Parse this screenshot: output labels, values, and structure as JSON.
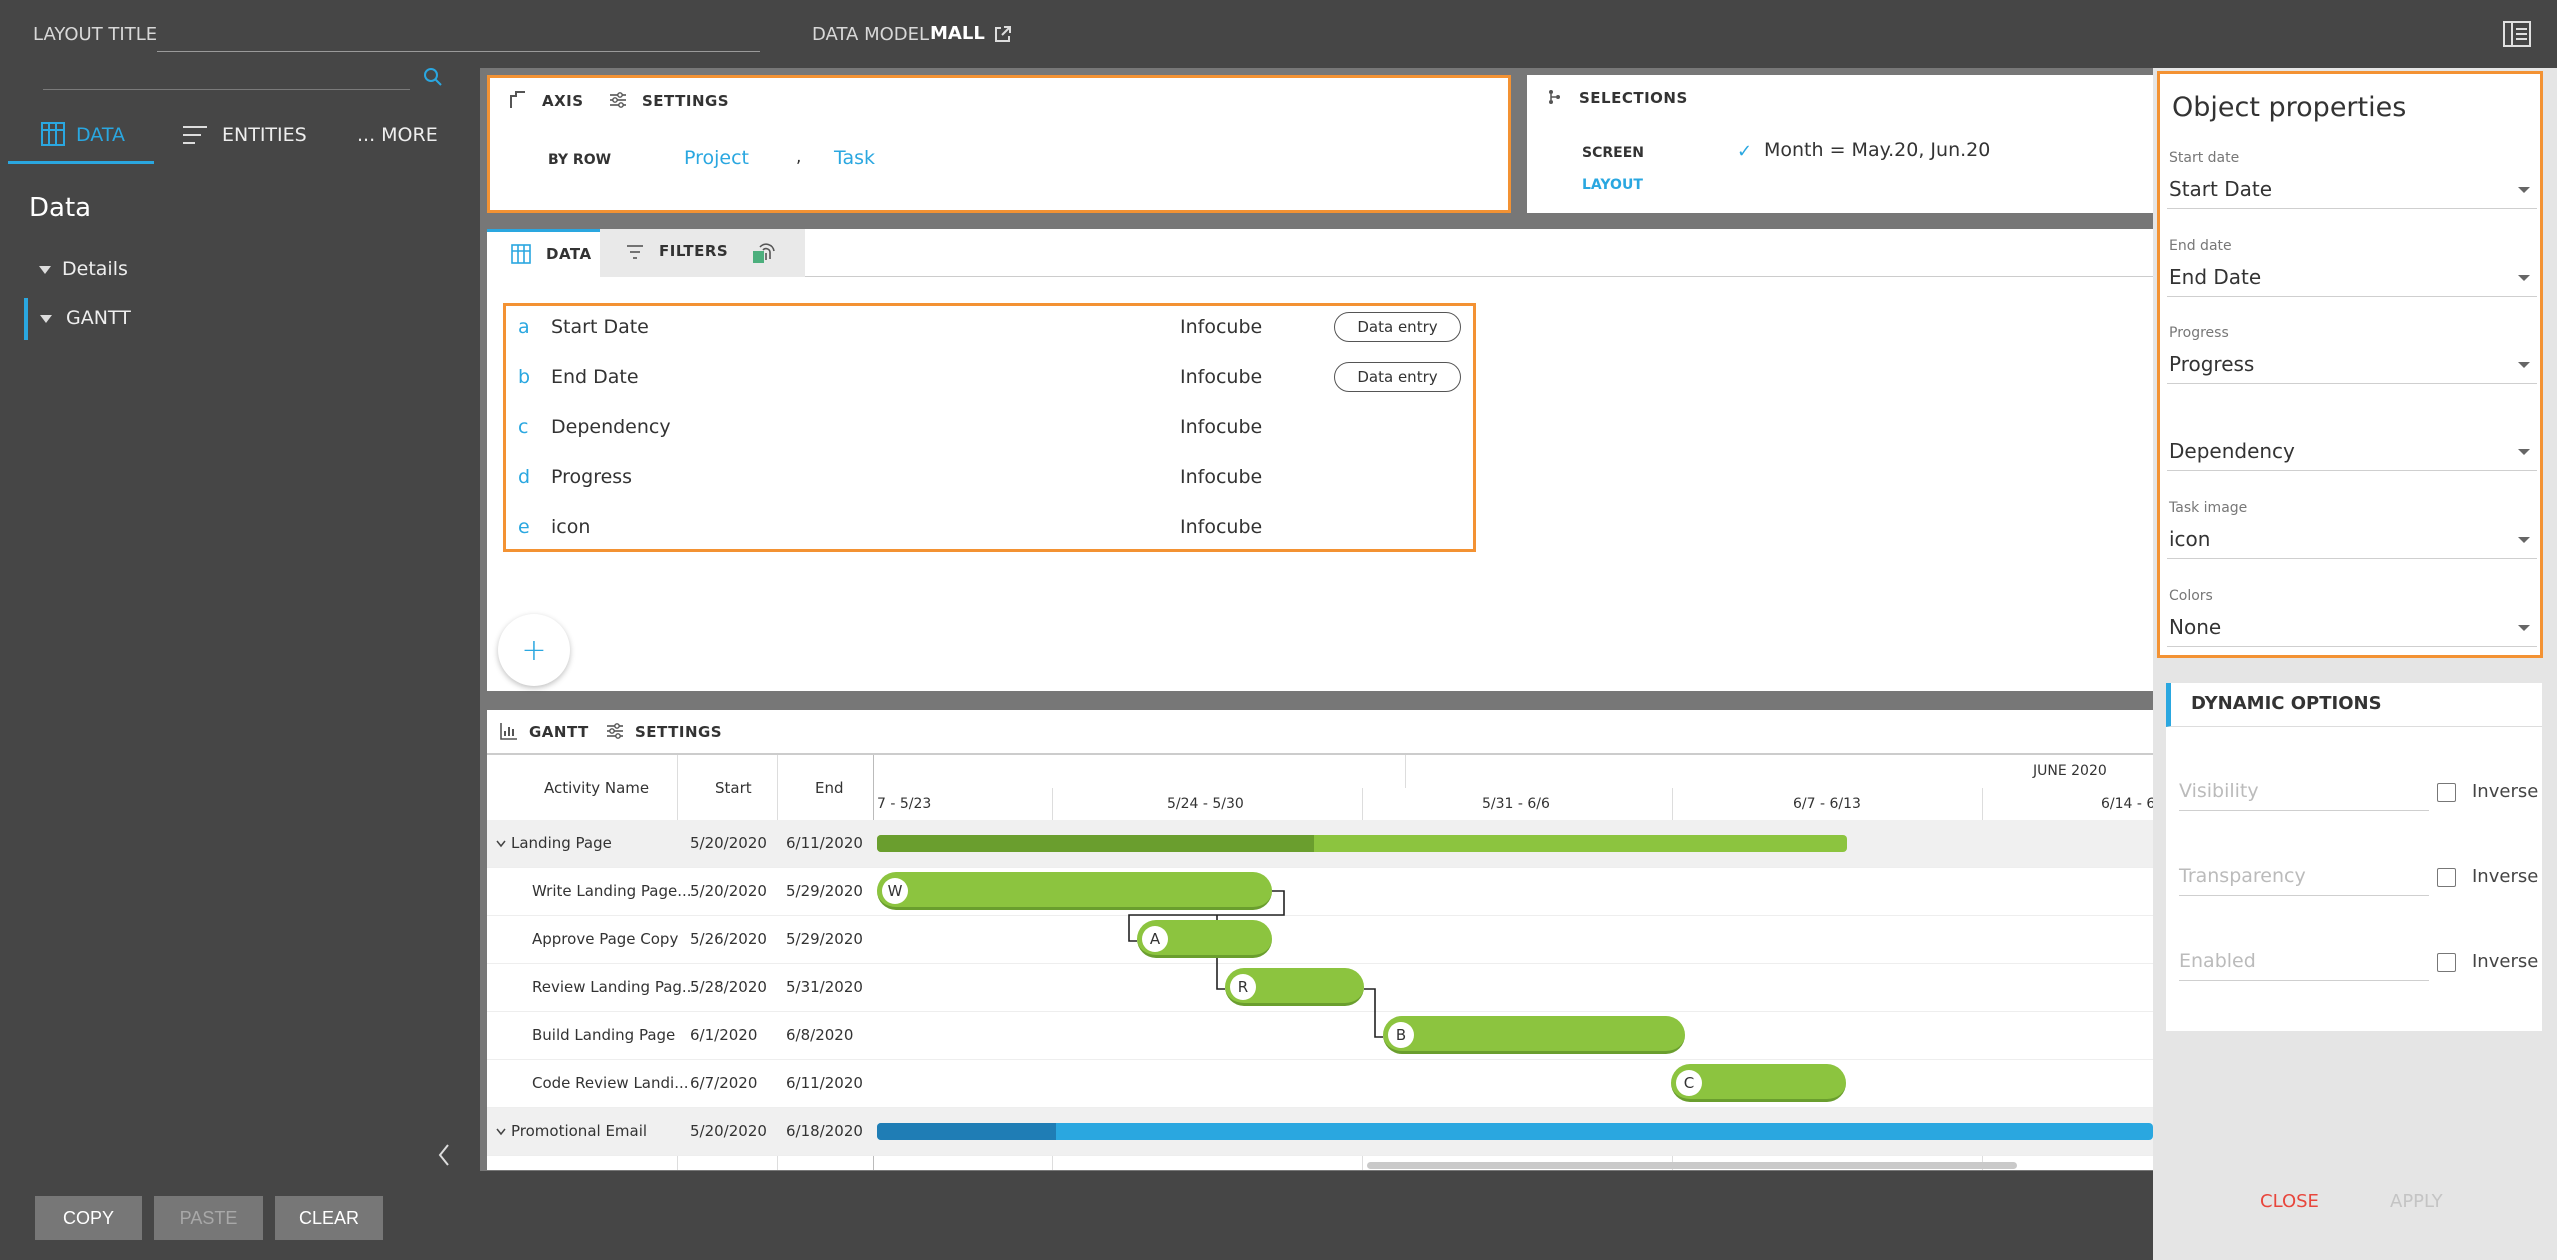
{
  "header": {
    "layout_title_label": "LAYOUT TITLE",
    "data_model_label": "DATA MODEL",
    "data_model_value": "MALL"
  },
  "left_panel": {
    "tabs": [
      "DATA",
      "ENTITIES",
      "... MORE"
    ],
    "section_title": "Data",
    "tree": [
      {
        "label": "Details"
      },
      {
        "label": "GANTT"
      }
    ],
    "buttons": {
      "copy": "COPY",
      "paste": "PASTE",
      "clear": "CLEAR"
    }
  },
  "axis_panel": {
    "tab_axis": "AXIS",
    "tab_settings": "SETTINGS",
    "by_row_label": "BY ROW",
    "row_items": [
      "Project",
      "Task"
    ],
    "separator": ","
  },
  "selections_panel": {
    "title": "SELECTIONS",
    "screen_label": "SCREEN",
    "screen_value": "Month = May.20, Jun.20",
    "layout_label": "LAYOUT"
  },
  "data_tabs": {
    "data": "DATA",
    "filters": "FILTERS"
  },
  "data_rows": [
    {
      "letter": "a",
      "name": "Start Date",
      "source": "Infocube",
      "action": "Data entry"
    },
    {
      "letter": "b",
      "name": "End Date",
      "source": "Infocube",
      "action": "Data entry"
    },
    {
      "letter": "c",
      "name": "Dependency",
      "source": "Infocube",
      "action": ""
    },
    {
      "letter": "d",
      "name": "Progress",
      "source": "Infocube",
      "action": ""
    },
    {
      "letter": "e",
      "name": "icon",
      "source": "Infocube",
      "action": ""
    }
  ],
  "add_button": "+",
  "gantt": {
    "tab_gantt": "GANTT",
    "tab_settings": "SETTINGS",
    "columns": {
      "activity": "Activity Name",
      "start": "Start",
      "end": "End"
    },
    "month_label": "JUNE 2020",
    "weeks": [
      "7 - 5/23",
      "5/24 - 5/30",
      "5/31 - 6/6",
      "6/7 - 6/13",
      "6/14 - 6/"
    ],
    "rows": [
      {
        "name": "Landing Page",
        "start": "5/20/2020",
        "end": "6/11/2020",
        "group": true,
        "bar_letter": "",
        "progress": 0.45
      },
      {
        "name": "Write Landing Page...",
        "start": "5/20/2020",
        "end": "5/29/2020",
        "group": false,
        "bar_letter": "W"
      },
      {
        "name": "Approve Page Copy",
        "start": "5/26/2020",
        "end": "5/29/2020",
        "group": false,
        "bar_letter": "A"
      },
      {
        "name": "Review Landing Pag...",
        "start": "5/28/2020",
        "end": "5/31/2020",
        "group": false,
        "bar_letter": "R"
      },
      {
        "name": "Build Landing Page",
        "start": "6/1/2020",
        "end": "6/8/2020",
        "group": false,
        "bar_letter": "B"
      },
      {
        "name": "Code Review Landi...",
        "start": "6/7/2020",
        "end": "6/11/2020",
        "group": false,
        "bar_letter": "C"
      },
      {
        "name": "Promotional Email",
        "start": "5/20/2020",
        "end": "6/18/2020",
        "group": true,
        "bar_letter": ""
      }
    ],
    "colors": {
      "green": "#8cc43f",
      "dark_green": "#6a9e2e",
      "blue": "#2aa7e0",
      "dark_blue": "#1f7db5"
    }
  },
  "object_properties": {
    "title": "Object properties",
    "fields": [
      {
        "label": "Start date",
        "value": "Start Date"
      },
      {
        "label": "End date",
        "value": "End Date"
      },
      {
        "label": "Progress",
        "value": "Progress"
      },
      {
        "label": "",
        "value": "Dependency"
      },
      {
        "label": "Task image",
        "value": "icon"
      },
      {
        "label": "Colors",
        "value": "None"
      }
    ],
    "dynamic_options": {
      "title": "DYNAMIC OPTIONS",
      "items": [
        {
          "placeholder": "Visibility",
          "inverse": "Inverse"
        },
        {
          "placeholder": "Transparency",
          "inverse": "Inverse"
        },
        {
          "placeholder": "Enabled",
          "inverse": "Inverse"
        }
      ]
    },
    "close": "CLOSE",
    "apply": "APPLY"
  },
  "colors": {
    "accent_blue": "#2aa7e0",
    "highlight_orange": "#f39233",
    "close_red": "#e8463c"
  }
}
